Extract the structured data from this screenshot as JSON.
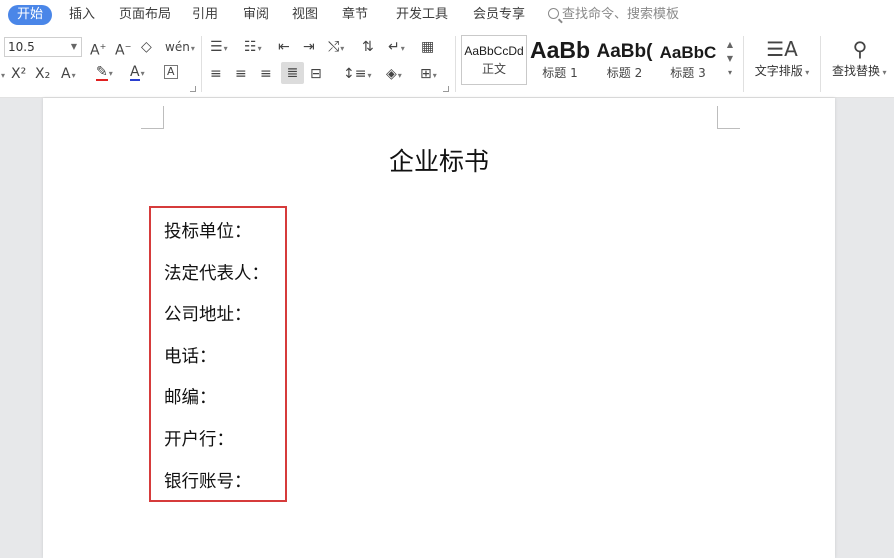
{
  "menu": {
    "tabs": [
      "开始",
      "插入",
      "页面布局",
      "引用",
      "审阅",
      "视图",
      "章节",
      "开发工具",
      "会员专享"
    ],
    "search_placeholder": "查找命令、搜索模板"
  },
  "ribbon": {
    "font_size": "10.5",
    "styles": [
      {
        "sample": "AaBbCcDd",
        "label": "正文"
      },
      {
        "sample": "AaBb",
        "label": "标题 1"
      },
      {
        "sample": "AaBb(",
        "label": "标题 2"
      },
      {
        "sample": "AaBbC",
        "label": "标题 3"
      }
    ],
    "text_layout_label": "文字排版",
    "find_replace_label": "查找替换"
  },
  "document": {
    "title": "企业标书",
    "fields": [
      "投标单位：",
      "法定代表人：",
      "公司地址：",
      "电话：",
      "邮编：",
      "开户行：",
      "银行账号："
    ]
  },
  "colors": {
    "active_tab": "#4a86e8",
    "highlight_box": "#d63b3b",
    "font_color_underline": "#2a3fd0",
    "highlight_underline": "#e02020"
  }
}
